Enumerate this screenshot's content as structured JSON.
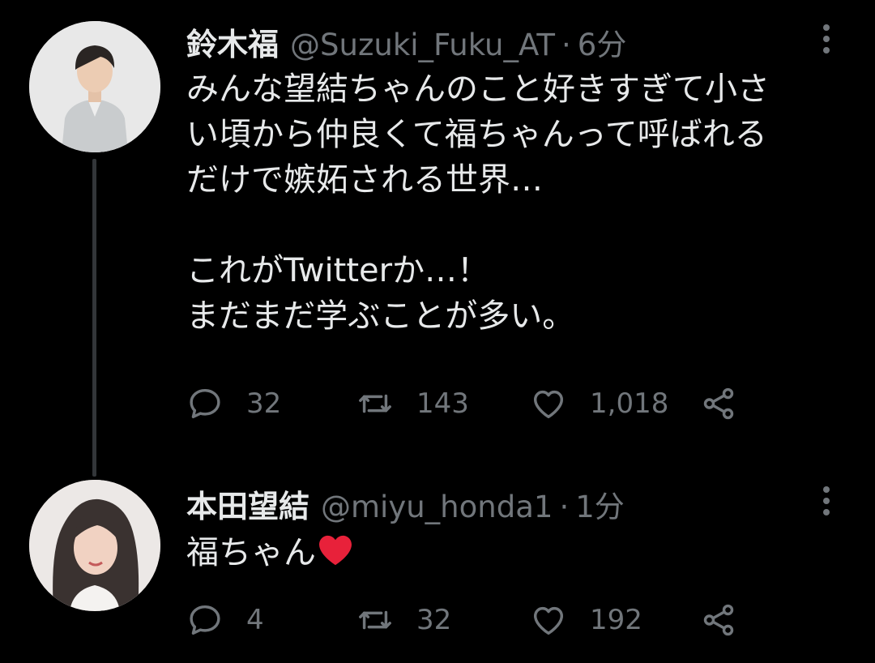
{
  "tweets": [
    {
      "author": {
        "display_name": "鈴木福",
        "handle": "@Suzuki_Fuku_AT"
      },
      "separator": "·",
      "time": "6分",
      "text_lines": [
        "みんな望結ちゃんのこと好きすぎて小さ",
        "い頃から仲良くて福ちゃんって呼ばれる",
        "だけで嫉妬される世界…",
        "",
        "これがTwitterか…！",
        "まだまだ学ぶことが多い。"
      ],
      "stats": {
        "replies": "32",
        "retweets": "143",
        "likes": "1,018"
      }
    },
    {
      "author": {
        "display_name": "本田望結",
        "handle": "@miyu_honda1"
      },
      "separator": "·",
      "time": "1分",
      "text_lines": [
        "福ちゃん"
      ],
      "emoji": "red-heart",
      "stats": {
        "replies": "4",
        "retweets": "32",
        "likes": "192"
      }
    }
  ],
  "icons": {
    "reply": "speech-bubble-icon",
    "retweet": "retweet-arrows-icon",
    "like": "heart-outline-icon",
    "share": "share-nodes-icon",
    "more": "vertical-dots-icon"
  },
  "colors": {
    "background": "#000000",
    "text": "#e7e9ea",
    "secondary": "#71767b",
    "thread_line": "#333639",
    "heart": "#e8213a"
  }
}
